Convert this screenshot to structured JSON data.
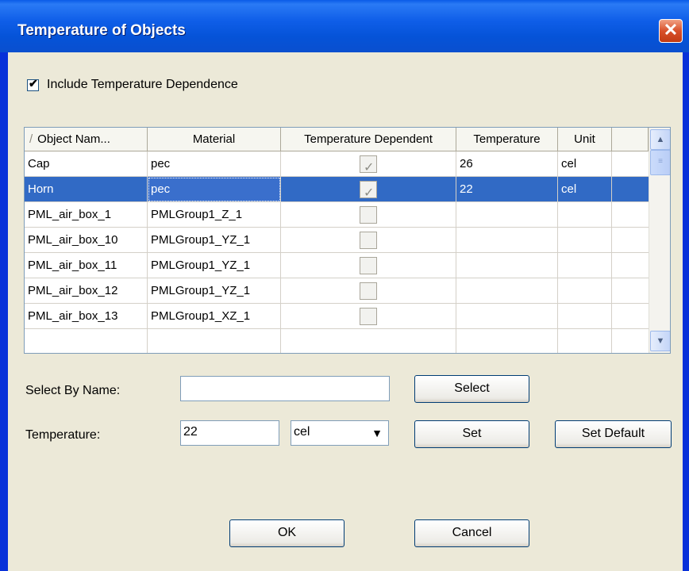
{
  "window": {
    "title": "Temperature of Objects",
    "close_glyph": "✕"
  },
  "include_checkbox": {
    "label": "Include Temperature Dependence",
    "checked": true
  },
  "grid": {
    "columns": [
      "Object Nam...",
      "Material",
      "Temperature Dependent",
      "Temperature",
      "Unit"
    ],
    "sort_indicator": "/",
    "rows": [
      {
        "name": "Cap",
        "material": "pec",
        "temp_dependent": true,
        "temperature": "26",
        "unit": "cel",
        "selected": false
      },
      {
        "name": "Horn",
        "material": "pec",
        "temp_dependent": true,
        "temperature": "22",
        "unit": "cel",
        "selected": true
      },
      {
        "name": "PML_air_box_1",
        "material": "PMLGroup1_Z_1",
        "temp_dependent": false,
        "temperature": "",
        "unit": "",
        "selected": false
      },
      {
        "name": "PML_air_box_10",
        "material": "PMLGroup1_YZ_1",
        "temp_dependent": false,
        "temperature": "",
        "unit": "",
        "selected": false
      },
      {
        "name": "PML_air_box_11",
        "material": "PMLGroup1_YZ_1",
        "temp_dependent": false,
        "temperature": "",
        "unit": "",
        "selected": false
      },
      {
        "name": "PML_air_box_12",
        "material": "PMLGroup1_YZ_1",
        "temp_dependent": false,
        "temperature": "",
        "unit": "",
        "selected": false
      },
      {
        "name": "PML_air_box_13",
        "material": "PMLGroup1_XZ_1",
        "temp_dependent": false,
        "temperature": "",
        "unit": "",
        "selected": false
      }
    ],
    "scroll_up_glyph": "▲",
    "scroll_down_glyph": "▼",
    "scroll_thumb_glyph": "≡"
  },
  "select_by_name": {
    "label": "Select By Name:",
    "value": "",
    "button": "Select"
  },
  "temperature": {
    "label": "Temperature:",
    "value": "22",
    "unit_selected": "cel",
    "set_button": "Set",
    "default_button": "Set Default",
    "arrow_glyph": "▼"
  },
  "footer": {
    "ok": "OK",
    "cancel": "Cancel"
  },
  "icons": {
    "checkmark": "✔",
    "tick": "✓"
  }
}
